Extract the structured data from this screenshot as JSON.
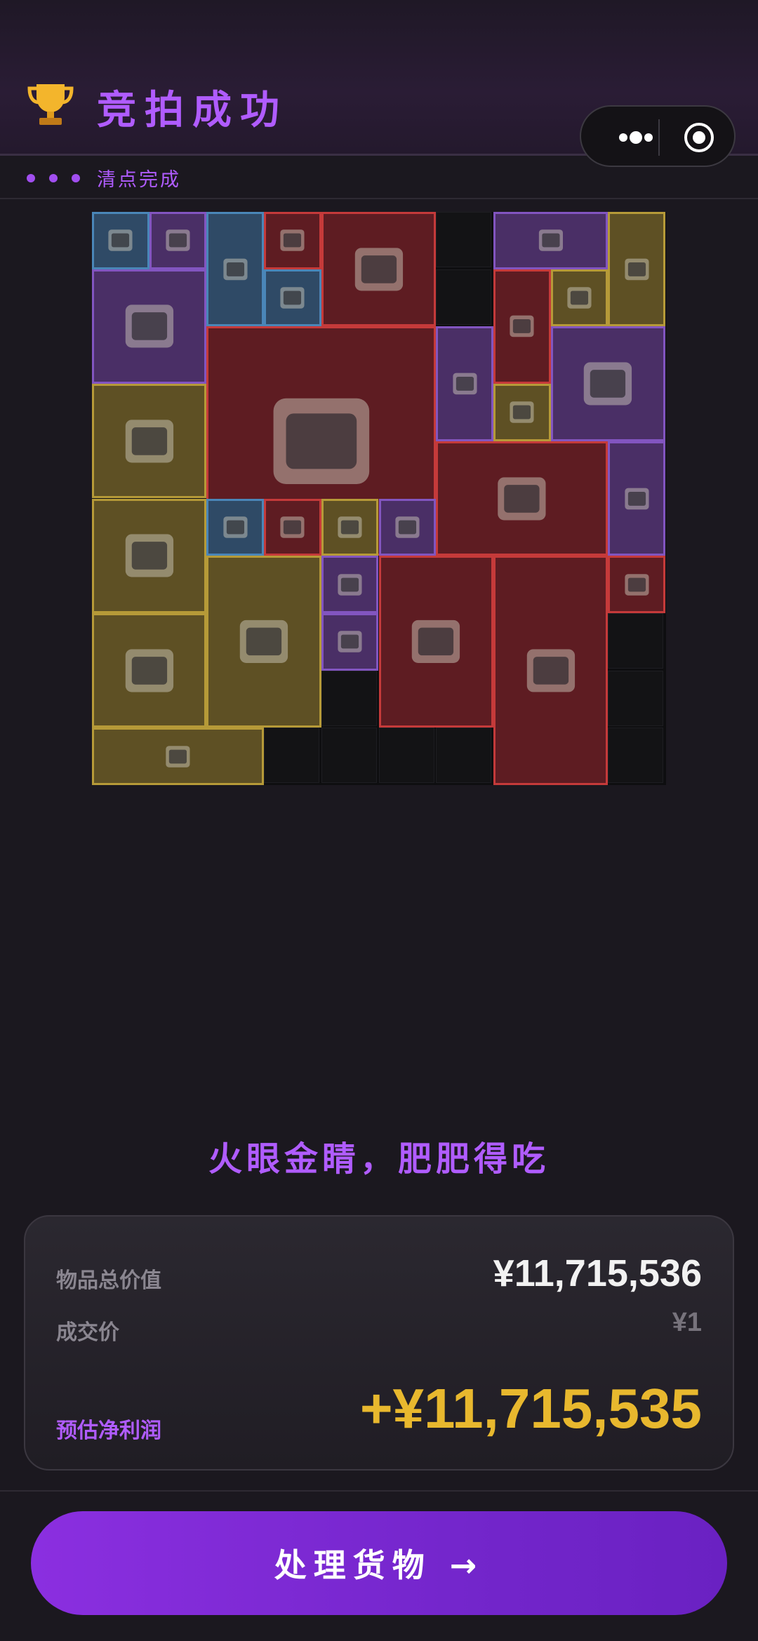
{
  "header": {
    "title": "竞拍成功",
    "trophy_icon": "trophy-icon",
    "capsule": {
      "more_icon": "more-dots-icon",
      "close_icon": "target-close-icon"
    }
  },
  "status": {
    "label": "清点完成",
    "dots_icon": "three-dots-icon"
  },
  "inventory": {
    "items": [
      {
        "name": "tablet-icon",
        "rarity": "blue"
      },
      {
        "name": "pen-icon",
        "rarity": "purple"
      },
      {
        "name": "telescope-icon",
        "rarity": "blue"
      },
      {
        "name": "tea-tin-icon",
        "rarity": "red"
      },
      {
        "name": "smartwatch-icon",
        "rarity": "blue"
      },
      {
        "name": "field-laptop-case-icon",
        "rarity": "red"
      },
      {
        "name": "camera-lens-icon",
        "rarity": "purple"
      },
      {
        "name": "coffee-box-icon",
        "rarity": "gold"
      },
      {
        "name": "centrifuge-icon",
        "rarity": "purple"
      },
      {
        "name": "ticket-icon",
        "rarity": "red"
      },
      {
        "name": "oximeter-icon",
        "rarity": "gold"
      },
      {
        "name": "battery-pack-icon",
        "rarity": "red"
      },
      {
        "name": "rock-sample-icon",
        "rarity": "purple"
      },
      {
        "name": "coffee-machine-icon",
        "rarity": "purple"
      },
      {
        "name": "multimeter-icon",
        "rarity": "gold"
      },
      {
        "name": "ammo-crate-icon",
        "rarity": "gold"
      },
      {
        "name": "vr-headset-icon",
        "rarity": "red"
      },
      {
        "name": "golden-arrow-icon",
        "rarity": "purple"
      },
      {
        "name": "reactor-icon",
        "rarity": "gold"
      },
      {
        "name": "medicine-bottle-icon",
        "rarity": "blue"
      },
      {
        "name": "tea-tin-2-icon",
        "rarity": "red"
      },
      {
        "name": "pearls-icon",
        "rarity": "gold"
      },
      {
        "name": "knife-icon",
        "rarity": "purple"
      },
      {
        "name": "porcelain-vase-icon",
        "rarity": "red"
      },
      {
        "name": "usb-drive-icon",
        "rarity": "red"
      },
      {
        "name": "power-station-icon",
        "rarity": "gold"
      },
      {
        "name": "battery-cell-icon",
        "rarity": "purple"
      },
      {
        "name": "aed-kit-icon",
        "rarity": "red"
      },
      {
        "name": "reactor-2-icon",
        "rarity": "gold"
      },
      {
        "name": "pen-2-icon",
        "rarity": "purple"
      },
      {
        "name": "red-case-icon",
        "rarity": "gold"
      }
    ]
  },
  "slogan": "火眼金睛，肥肥得吃",
  "summary": {
    "total_label": "物品总价值",
    "total_value": "¥11,715,536",
    "deal_label": "成交价",
    "deal_value": "¥1",
    "profit_label": "预估净利润",
    "profit_value": "+¥11,715,535"
  },
  "cta": {
    "label": "处理货物 →"
  },
  "colors": {
    "accent": "#b05cff",
    "profit": "#e8b82e",
    "blue": "#4a86b8",
    "purple": "#8255c0",
    "gold": "#b69a38",
    "red": "#c53a3a"
  }
}
